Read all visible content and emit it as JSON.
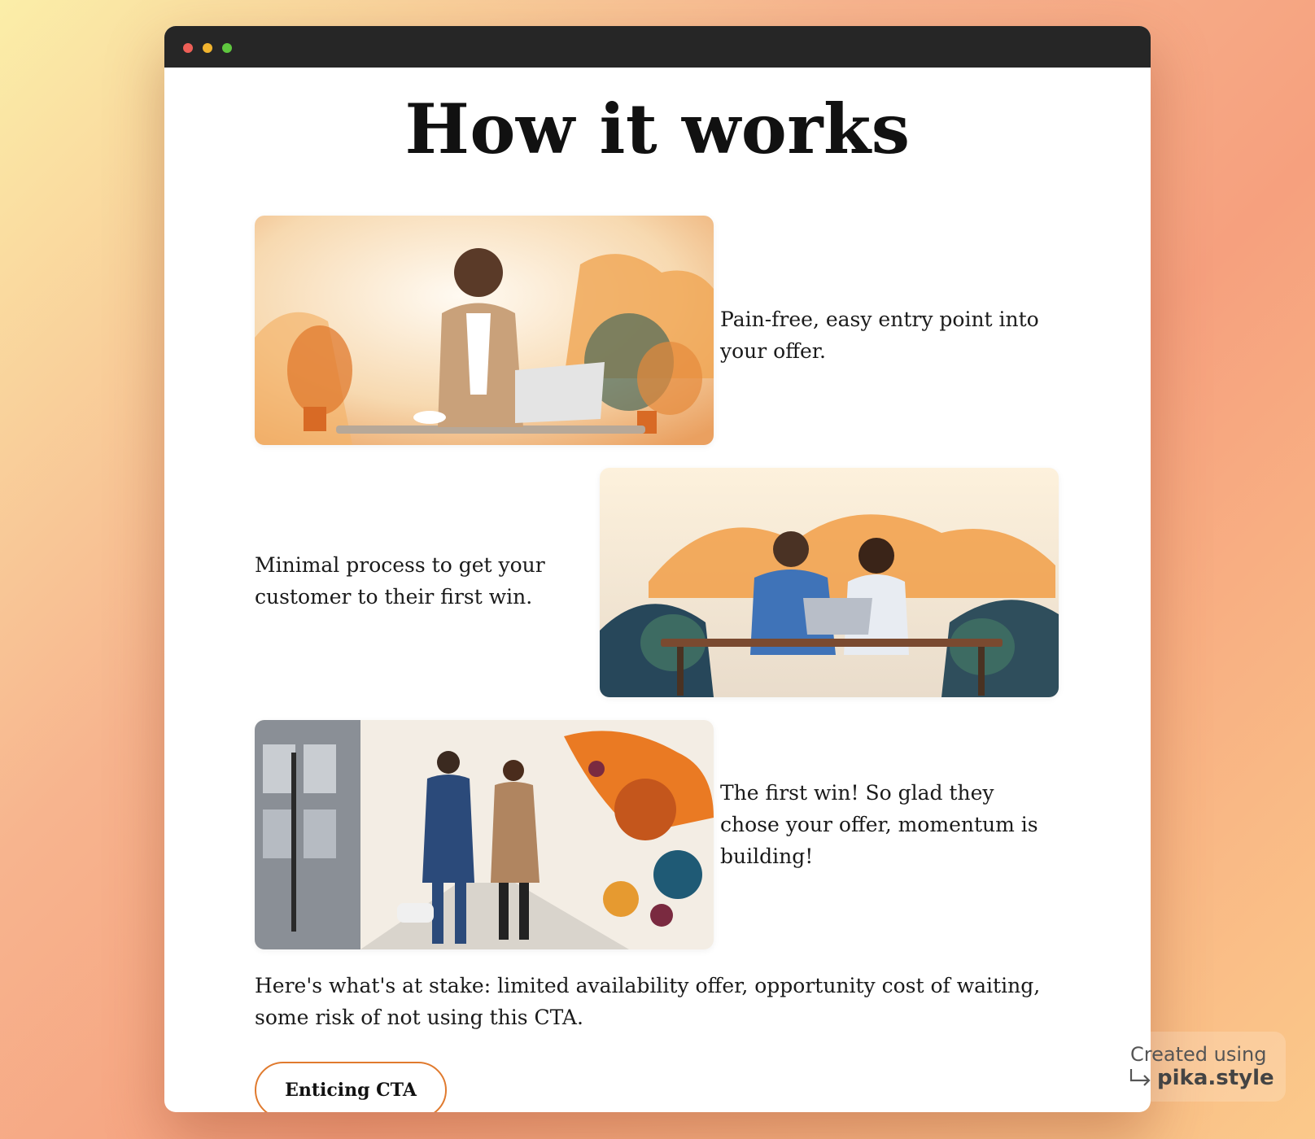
{
  "window": {
    "controls": [
      "close",
      "minimize",
      "maximize"
    ]
  },
  "page": {
    "title": "How it works",
    "steps": [
      {
        "text": "Pain-free, easy entry point into your offer.",
        "image_icon": "woman-with-laptop-illustration"
      },
      {
        "text": "Minimal process to get your customer to their first win.",
        "image_icon": "couple-at-laptop-illustration"
      },
      {
        "text": "The first win! So glad they chose your offer, momentum is building!",
        "image_icon": "couple-walking-city-illustration"
      }
    ],
    "stakes": "Here's what's at stake: limited availability offer, opportunity cost of waiting, some risk of not using this CTA.",
    "cta_label": "Enticing CTA"
  },
  "watermark": {
    "line1": "Created using",
    "line2": "pika.style"
  },
  "colors": {
    "accent": "#e07a2e",
    "titlebar": "#262626",
    "text": "#1a1a1a"
  }
}
